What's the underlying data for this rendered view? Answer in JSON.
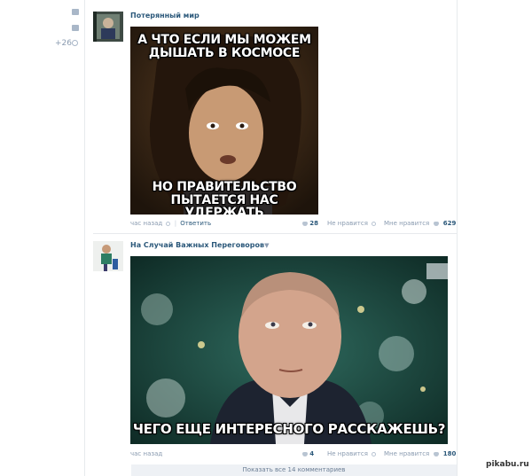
{
  "sidebar": {
    "counter": "+26",
    "icons": [
      "envelope-icon",
      "comment-icon",
      "gear-icon"
    ]
  },
  "posts": [
    {
      "author": "Потерянный мир",
      "meme_top": "А ЧТО ЕСЛИ МЫ МОЖЕМ ДЫШАТЬ В КОСМОСЕ",
      "meme_bottom": "НО ПРАВИТЕЛЬСТВО ПЫТАЕТСЯ НАС УДЕРЖАТЬ",
      "time": "час назад",
      "reply": "Ответить",
      "reposts": "28",
      "dislike_label": "Не нравится",
      "like_label": "Мне нравится",
      "likes": "629"
    },
    {
      "author": "На Случай Важных Переговоров",
      "meme_bottom": "ЧЕГО ЕЩЕ ИНТЕРЕСНОГО РАССКАЖЕШЬ?",
      "time": "час назад",
      "reposts": "4",
      "dislike_label": "Не нравится",
      "like_label": "Мне нравится",
      "likes": "180"
    }
  ],
  "show_comments": "Показать все 14 комментариев",
  "watermark": "pikabu.ru",
  "colors": {
    "link": "#2b587a",
    "muted": "#8a9bb0",
    "divider": "#e7eaed"
  }
}
